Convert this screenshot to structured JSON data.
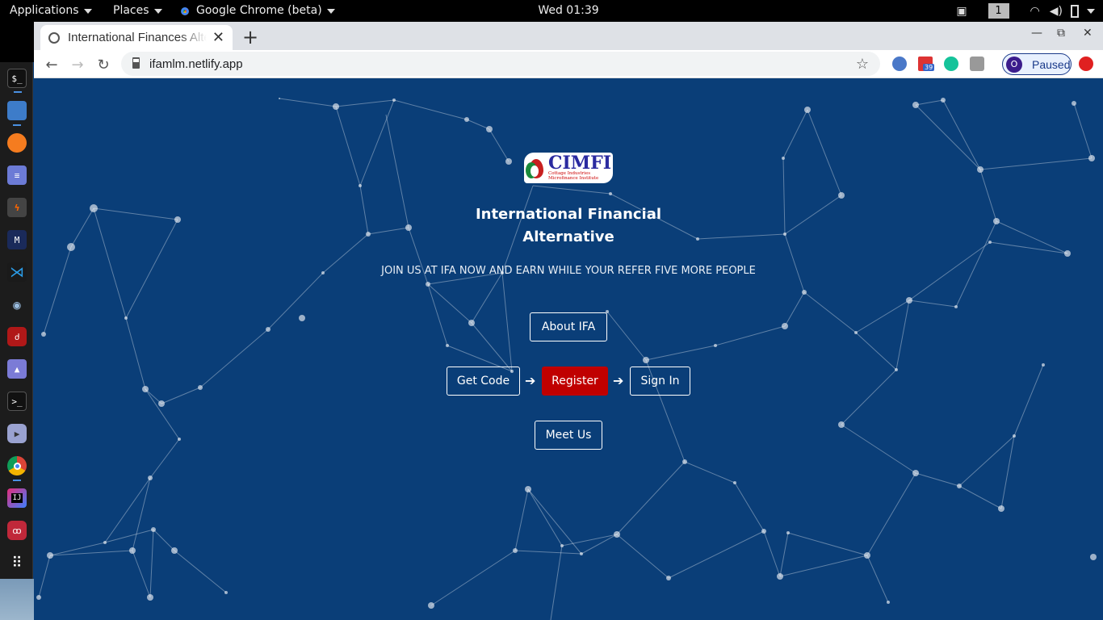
{
  "system_bar": {
    "applications": "Applications",
    "places": "Places",
    "active_app": "Google Chrome (beta)",
    "clock": "Wed 01:39",
    "workspace": "1"
  },
  "dock": {
    "items": [
      "terminal-icon",
      "files-icon",
      "firefox-icon",
      "text-editor-icon",
      "burp-icon",
      "malwarebytes-icon",
      "vscode-icon",
      "eye-icon",
      "cherrytree-icon",
      "image-viewer-icon",
      "terminal2-icon",
      "media-player-icon",
      "chrome-icon",
      "intellij-icon",
      "glasses-icon",
      "app-grid-icon"
    ]
  },
  "browser": {
    "tab_title": "International Finances Alternative",
    "url": "ifamlm.netlify.app",
    "profile_initial": "O",
    "profile_label": "Paused",
    "extension_badge": "39"
  },
  "page": {
    "logo_text": "CIMFI",
    "logo_subtext_1": "Cottage Industries",
    "logo_subtext_2": "Microfinance Institute",
    "title_line1": "International Financial",
    "title_line2": "Alternative",
    "tagline": "JOIN US AT IFA NOW AND EARN WHILE YOUR REFER FIVE MORE PEOPLE",
    "about_button": "About IFA",
    "get_code_button": "Get Code",
    "register_button": "Register",
    "sign_in_button": "Sign In",
    "meet_us_button": "Meet Us",
    "colors": {
      "background": "#0a3e78",
      "register": "#c00000"
    }
  }
}
